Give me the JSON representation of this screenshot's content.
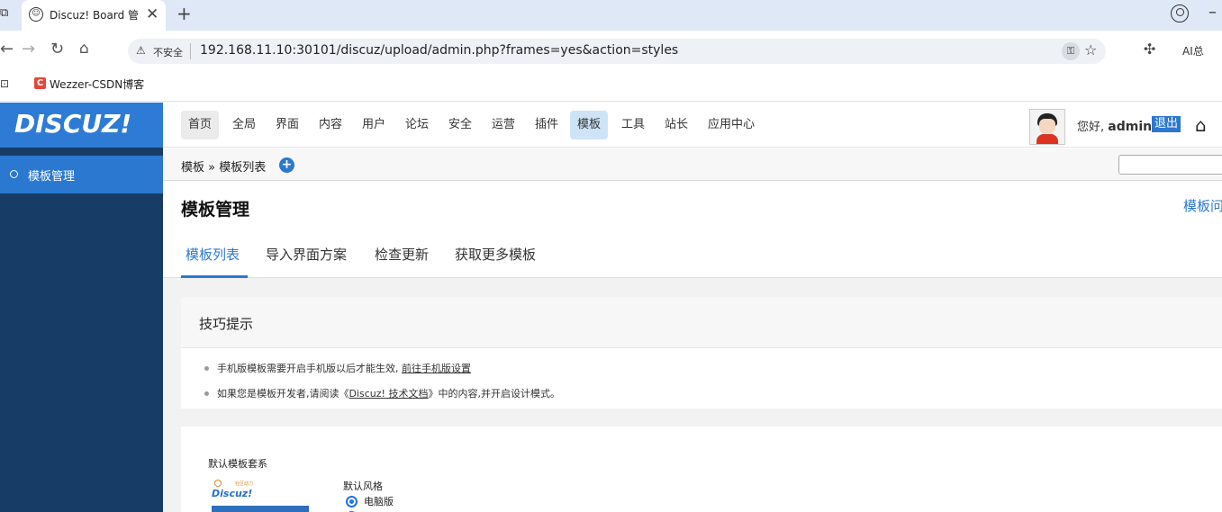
{
  "browser": {
    "tab_title": "Discuz! Board 管",
    "close_glyph": "✕",
    "newtab_glyph": "+",
    "insecure_label": "不安全",
    "url": "192.168.11.10:30101/discuz/upload/admin.php?frames=yes&action=styles",
    "ai_label": "AI总",
    "bookmark_label": "Wezzer-CSDN博客"
  },
  "brand": {
    "logo": "DISCUZ!"
  },
  "topnav": {
    "items": [
      "首页",
      "全局",
      "界面",
      "内容",
      "用户",
      "论坛",
      "安全",
      "运营",
      "插件",
      "模板",
      "工具",
      "站长",
      "应用中心"
    ],
    "active": "模板",
    "greeting": "您好,",
    "username": "admin",
    "logout": "退出"
  },
  "sidebar": {
    "items": [
      {
        "label": "模板管理"
      }
    ]
  },
  "breadcrumb": {
    "text": "模板 » 模板列表"
  },
  "main": {
    "title": "模板管理",
    "help": "模板问",
    "tabs": [
      "模板列表",
      "导入界面方案",
      "检查更新",
      "获取更多模板"
    ]
  },
  "tips": {
    "title": "技巧提示",
    "row1_text": "手机版模板需要开启手机版以后才能生效,",
    "row1_link": "前往手机版设置",
    "row2_prefix": "如果您是模板开发者,请阅读《",
    "row2_link": "Discuz! 技术文档",
    "row2_suffix": "》中的内容,并开启设计模式。"
  },
  "card": {
    "label": "默认模板套系",
    "thumb_logo": "Discuz!",
    "thumb_tag": "社区动力",
    "style_label": "默认风格",
    "radio_pc": "电脑版"
  },
  "colors": {
    "accent": "#2b78d0",
    "sidebar": "#173d67",
    "logo_bg": "#2d7bd4"
  }
}
